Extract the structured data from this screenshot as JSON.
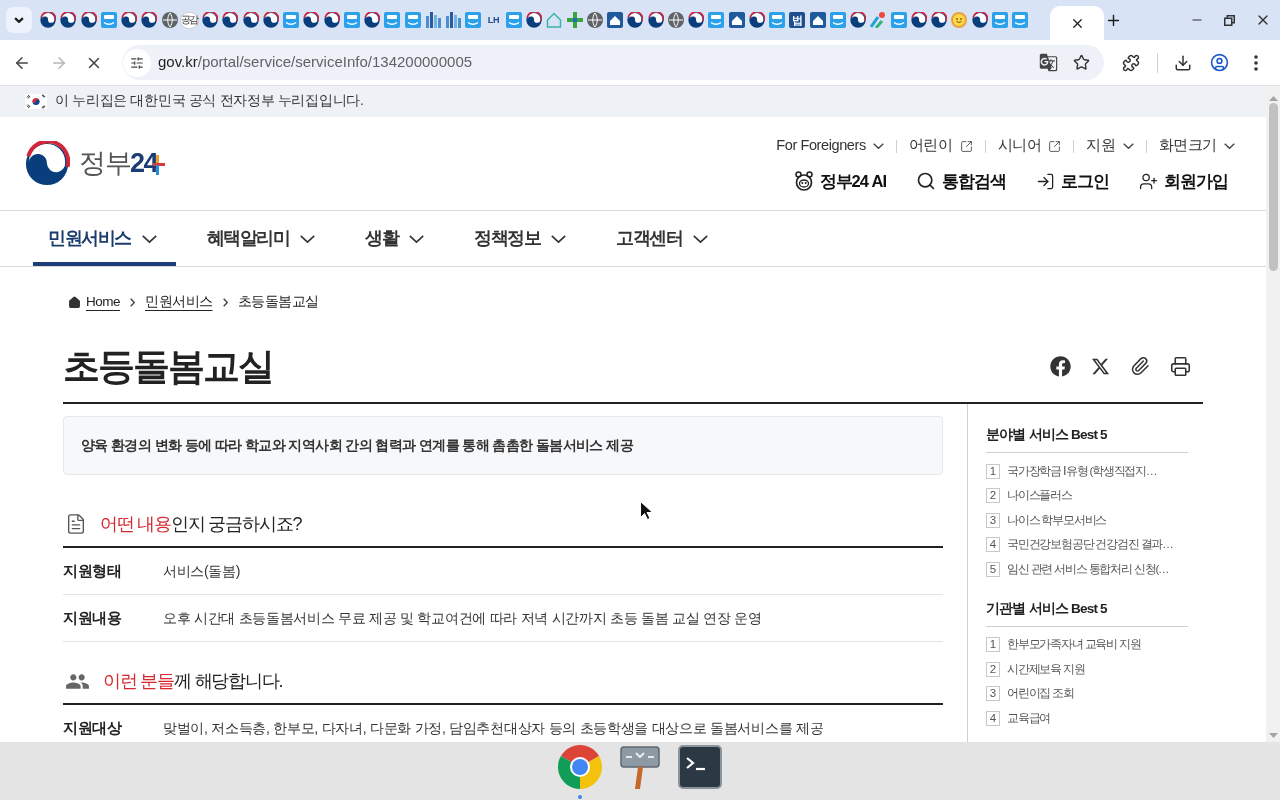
{
  "browser": {
    "tabs": [
      {
        "kind": "emblem",
        "selected": false
      },
      {
        "kind": "emblem",
        "selected": false
      },
      {
        "kind": "emblem",
        "selected": false
      },
      {
        "kind": "tile",
        "selected": false
      },
      {
        "kind": "emblem",
        "selected": false
      },
      {
        "kind": "emblem",
        "selected": false
      },
      {
        "kind": "globe",
        "selected": false
      },
      {
        "kind": "text-circle",
        "text": "공감",
        "selected": false
      },
      {
        "kind": "emblem",
        "selected": false
      },
      {
        "kind": "emblem",
        "selected": false
      },
      {
        "kind": "emblem",
        "selected": false
      },
      {
        "kind": "emblem",
        "selected": false
      },
      {
        "kind": "tile",
        "selected": false
      },
      {
        "kind": "emblem",
        "selected": false
      },
      {
        "kind": "emblem",
        "selected": false
      },
      {
        "kind": "tile",
        "selected": false
      },
      {
        "kind": "emblem",
        "selected": false
      },
      {
        "kind": "tile",
        "selected": false
      },
      {
        "kind": "tile",
        "selected": false
      },
      {
        "kind": "building",
        "selected": false
      },
      {
        "kind": "building",
        "selected": false
      },
      {
        "kind": "tile",
        "selected": false
      },
      {
        "kind": "text-mark",
        "text": "LH",
        "selected": false
      },
      {
        "kind": "tile",
        "selected": false
      },
      {
        "kind": "emblem",
        "selected": false
      },
      {
        "kind": "house",
        "selected": false
      },
      {
        "kind": "cross",
        "selected": false
      },
      {
        "kind": "globe",
        "selected": false
      },
      {
        "kind": "home-tile",
        "selected": false
      },
      {
        "kind": "emblem",
        "selected": false
      },
      {
        "kind": "emblem",
        "selected": false
      },
      {
        "kind": "globe",
        "selected": false
      },
      {
        "kind": "emblem",
        "selected": false
      },
      {
        "kind": "tile",
        "selected": false
      },
      {
        "kind": "home-tile",
        "selected": false
      },
      {
        "kind": "emblem",
        "selected": false
      },
      {
        "kind": "tile",
        "selected": false
      },
      {
        "kind": "text-tile",
        "text": "법",
        "selected": false
      },
      {
        "kind": "home-tile",
        "selected": false
      },
      {
        "kind": "tile",
        "selected": false
      },
      {
        "kind": "emblem",
        "selected": false
      },
      {
        "kind": "pinwheel",
        "selected": false
      },
      {
        "kind": "tile",
        "selected": false
      },
      {
        "kind": "emblem",
        "selected": false
      },
      {
        "kind": "emblem",
        "selected": false
      },
      {
        "kind": "smiley",
        "selected": false
      },
      {
        "kind": "emblem",
        "selected": false
      },
      {
        "kind": "tile",
        "selected": false
      },
      {
        "kind": "tile",
        "selected": false
      },
      {
        "kind": "blank",
        "selected": true
      }
    ],
    "forward_enabled": false,
    "loading": true,
    "url": {
      "host": "gov.kr",
      "path": "/portal/service/serviceInfo/134200000005"
    }
  },
  "gov_banner": {
    "text": "이 누리집은 대한민국 공식 전자정부 누리집입니다."
  },
  "logo": {
    "word": "정부",
    "number": "24"
  },
  "utility_links": [
    {
      "label": "For Foreigners",
      "kind": "dropdown"
    },
    {
      "label": "어린이",
      "kind": "external"
    },
    {
      "label": "시니어",
      "kind": "external"
    },
    {
      "label": "지원",
      "kind": "dropdown"
    },
    {
      "label": "화면크기",
      "kind": "dropdown"
    }
  ],
  "quick_actions": [
    {
      "label": "정부24 AI",
      "kind": "ai"
    },
    {
      "label": "통합검색",
      "kind": "search"
    },
    {
      "label": "로그인",
      "kind": "login"
    },
    {
      "label": "회원가입",
      "kind": "signup"
    }
  ],
  "nav": [
    {
      "label": "민원서비스",
      "selected": true
    },
    {
      "label": "혜택알리미",
      "selected": false
    },
    {
      "label": "생활",
      "selected": false
    },
    {
      "label": "정책정보",
      "selected": false
    },
    {
      "label": "고객센터",
      "selected": false
    }
  ],
  "breadcrumb": [
    {
      "label": "Home",
      "kind": "home"
    },
    {
      "label": "민원서비스",
      "kind": "link"
    },
    {
      "label": "초등돌봄교실",
      "kind": "current"
    }
  ],
  "title": "초등돌봄교실",
  "summary": "양육 환경의 변화 등에 따라 학교와 지역사회 간의 협력과 연계를 통해 촘촘한 돌봄서비스 제공",
  "sections": [
    {
      "kind": "document",
      "highlight": "어떤 내용",
      "rest": "인지 궁금하시죠?",
      "rows": [
        {
          "label": "지원형태",
          "value": "서비스(돌봄)"
        },
        {
          "label": "지원내용",
          "value": "오후 시간대 초등돌봄서비스 무료 제공 및 학교여건에 따라 저녁 시간까지 초등 돌봄 교실 연장 운영"
        }
      ]
    },
    {
      "kind": "people",
      "highlight": "이런 분들",
      "rest": "께 해당합니다.",
      "rows": [
        {
          "label": "지원대상",
          "value": "맞벌이, 저소득층, 한부모, 다자녀, 다문화 가정, 담임추천대상자 등의 초등학생을 대상으로 돌봄서비스를 제공"
        }
      ]
    }
  ],
  "sidebar": [
    {
      "title": "분야별 서비스 Best 5",
      "items": [
        {
          "rank": "1",
          "label": "국가장학금 Ⅰ유형 (학생직접지…"
        },
        {
          "rank": "2",
          "label": "나이스플러스"
        },
        {
          "rank": "3",
          "label": "나이스 학부모서비스"
        },
        {
          "rank": "4",
          "label": "국민건강보험공단 건강검진 결과…"
        },
        {
          "rank": "5",
          "label": "임신 관련 서비스 통합처리 신청(…"
        }
      ]
    },
    {
      "title": "기관별 서비스 Best 5",
      "items": [
        {
          "rank": "1",
          "label": "한부모가족자녀 교육비 지원"
        },
        {
          "rank": "2",
          "label": "시간제보육 지원"
        },
        {
          "rank": "3",
          "label": "어린이집 조회"
        },
        {
          "rank": "4",
          "label": "교육급여"
        }
      ]
    }
  ],
  "taskbar": [
    {
      "kind": "chrome",
      "running": true
    },
    {
      "kind": "signpost",
      "running": false
    },
    {
      "kind": "terminal",
      "running": false
    }
  ]
}
